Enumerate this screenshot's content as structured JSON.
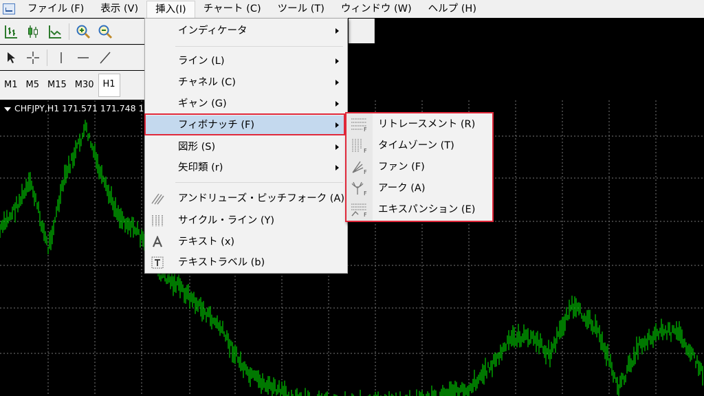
{
  "menubar": {
    "items": [
      "ファイル (F)",
      "表示 (V)",
      "挿入(I)",
      "チャート (C)",
      "ツール (T)",
      "ウィンドウ (W)",
      "ヘルプ (H)"
    ]
  },
  "timeframes": [
    "M1",
    "M5",
    "M15",
    "M30",
    "H1"
  ],
  "chart": {
    "title": "CHFJPY,H1  171.571 171.748 1",
    "line_color": "#00c800",
    "grid_color": "#7a7a7a"
  },
  "insert_menu": {
    "items": [
      {
        "label": "インディケータ",
        "submenu": true
      },
      {
        "label": "ライン (L)",
        "submenu": true
      },
      {
        "label": "チャネル (C)",
        "submenu": true
      },
      {
        "label": "ギャン (G)",
        "submenu": true
      },
      {
        "label": "フィボナッチ (F)",
        "submenu": true
      },
      {
        "label": "図形 (S)",
        "submenu": true
      },
      {
        "label": "矢印類 (r)",
        "submenu": true
      },
      {
        "label": "アンドリューズ・ピッチフォーク (A)",
        "icon": "pitchfork-icon"
      },
      {
        "label": "サイクル・ライン (Y)",
        "icon": "cycle-lines-icon"
      },
      {
        "label": "テキスト (x)",
        "icon": "text-icon"
      },
      {
        "label": "テキストラベル (b)",
        "icon": "text-label-icon"
      }
    ]
  },
  "fibonacci_submenu": {
    "items": [
      {
        "label": "リトレースメント (R)",
        "icon": "fibo-retracement-icon"
      },
      {
        "label": "タイムゾーン (T)",
        "icon": "fibo-timezones-icon"
      },
      {
        "label": "ファン (F)",
        "icon": "fibo-fan-icon"
      },
      {
        "label": "アーク (A)",
        "icon": "fibo-arcs-icon"
      },
      {
        "label": "エキスパンション (E)",
        "icon": "fibo-expansion-icon"
      }
    ]
  },
  "colors": {
    "highlight": "#c4d9ee",
    "annotation_border": "#e0283a"
  }
}
